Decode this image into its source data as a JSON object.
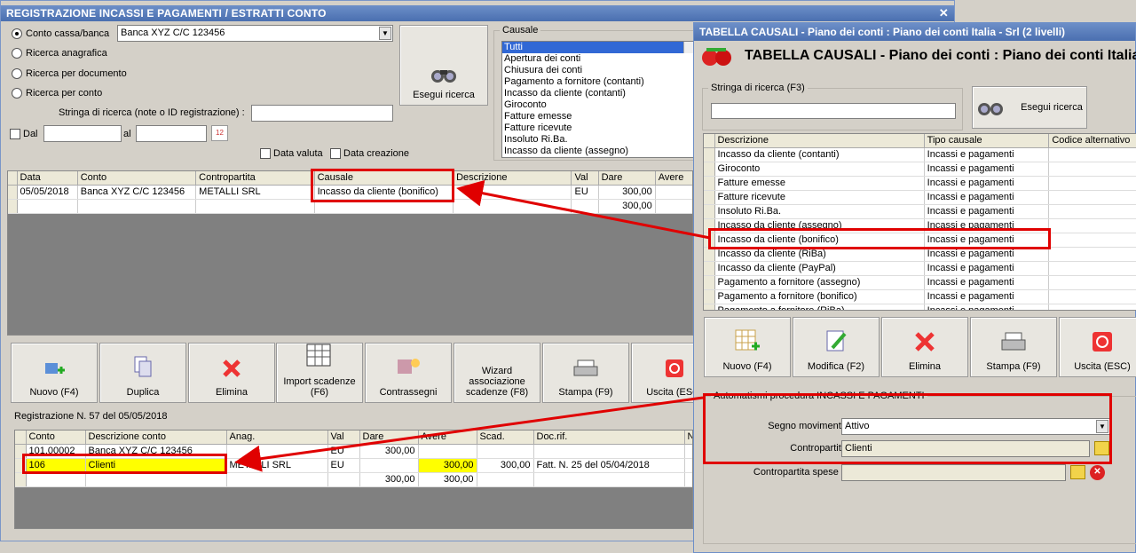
{
  "main": {
    "title": "REGISTRAZIONE INCASSI E PAGAMENTI / ESTRATTI CONTO",
    "radios": [
      "Conto cassa/banca",
      "Ricerca anagrafica",
      "Ricerca per documento",
      "Ricerca per conto"
    ],
    "account_select": "Banca XYZ C/C 123456",
    "search_label": "Stringa di ricerca (note o ID registrazione) :",
    "dal_label": "Dal",
    "al_label": "al",
    "data_valuta": "Data valuta",
    "data_creazione": "Data creazione",
    "search_button": "Esegui ricerca",
    "causale_title": "Causale",
    "causale_items": [
      "Tutti",
      "Apertura dei conti",
      "Chiusura dei conti",
      "Pagamento a fornitore (contanti)",
      "Incasso da cliente (contanti)",
      "Giroconto",
      "Fatture emesse",
      "Fatture ricevute",
      "Insoluto Ri.Ba.",
      "Incasso da cliente (assegno)"
    ],
    "grid1": {
      "headers": [
        "Data",
        "Conto",
        "Contropartita",
        "Causale",
        "Descrizione",
        "Val",
        "Dare",
        "Avere"
      ],
      "row": [
        "05/05/2018",
        "Banca XYZ C/C 123456",
        "METALLI SRL",
        "Incasso da cliente (bonifico)",
        "",
        "EU",
        "300,00",
        ""
      ],
      "total_dare": "300,00"
    },
    "buttons": [
      "Nuovo (F4)",
      "Duplica",
      "Elimina",
      "Import scadenze (F6)",
      "Contrassegni",
      "Wizard associazione scadenze (F8)",
      "Stampa (F9)",
      "Uscita (ESC)"
    ],
    "reg_label": "Registrazione N. 57 del 05/05/2018",
    "grid2": {
      "headers": [
        "Conto",
        "Descrizione conto",
        "Anag.",
        "Val",
        "Dare",
        "Avere",
        "Scad.",
        "Doc.rif.",
        "N"
      ],
      "rows": [
        [
          "101.00002",
          "Banca XYZ C/C 123456",
          "",
          "EU",
          "300,00",
          "",
          "",
          "",
          ""
        ],
        [
          "106",
          "Clienti",
          "METALLI SRL",
          "EU",
          "",
          "300,00",
          "300,00",
          "Fatt. N. 25 del 05/04/2018",
          ""
        ],
        [
          "",
          "",
          "",
          "",
          "300,00",
          "300,00",
          "",
          "",
          ""
        ]
      ]
    }
  },
  "causali": {
    "title": "TABELLA CAUSALI - Piano dei conti : Piano dei conti Italia - Srl (2 livelli)",
    "header": "TABELLA CAUSALI - Piano dei conti : Piano dei conti Italia",
    "search_group": "Stringa di ricerca (F3)",
    "search_button": "Esegui ricerca",
    "headers": [
      "Descrizione",
      "Tipo causale",
      "Codice alternativo"
    ],
    "rows": [
      [
        "Incasso da cliente (contanti)",
        "Incassi e pagamenti"
      ],
      [
        "Giroconto",
        "Incassi e pagamenti"
      ],
      [
        "Fatture emesse",
        "Incassi e pagamenti"
      ],
      [
        "Fatture ricevute",
        "Incassi e pagamenti"
      ],
      [
        "Insoluto Ri.Ba.",
        "Incassi e pagamenti"
      ],
      [
        "Incasso da cliente (assegno)",
        "Incassi e pagamenti"
      ],
      [
        "Incasso da cliente (bonifico)",
        "Incassi e pagamenti"
      ],
      [
        "Incasso da cliente (RiBa)",
        "Incassi e pagamenti"
      ],
      [
        "Incasso da cliente (PayPal)",
        "Incassi e pagamenti"
      ],
      [
        "Pagamento a fornitore (assegno)",
        "Incassi e pagamenti"
      ],
      [
        "Pagamento a fornitore (bonifico)",
        "Incassi e pagamenti"
      ],
      [
        "Pagamento a fornitore (RiBa)",
        "Incassi e pagamenti"
      ]
    ],
    "buttons": [
      "Nuovo (F4)",
      "Modifica (F2)",
      "Elimina",
      "Stampa (F9)",
      "Uscita (ESC)"
    ],
    "auto_group": "Automatismi procedura INCASSI E PAGAMENTI",
    "segno_label": "Segno movimento :",
    "segno_value": "Attivo",
    "contro_label": "Contropartita :",
    "contro_value": "Clienti",
    "spese_label": "Contropartita spese :",
    "spese_value": ""
  },
  "colors": {
    "highlight": "#e00000",
    "title_bar": "#4a6fb0",
    "yellow": "#ffff00"
  }
}
